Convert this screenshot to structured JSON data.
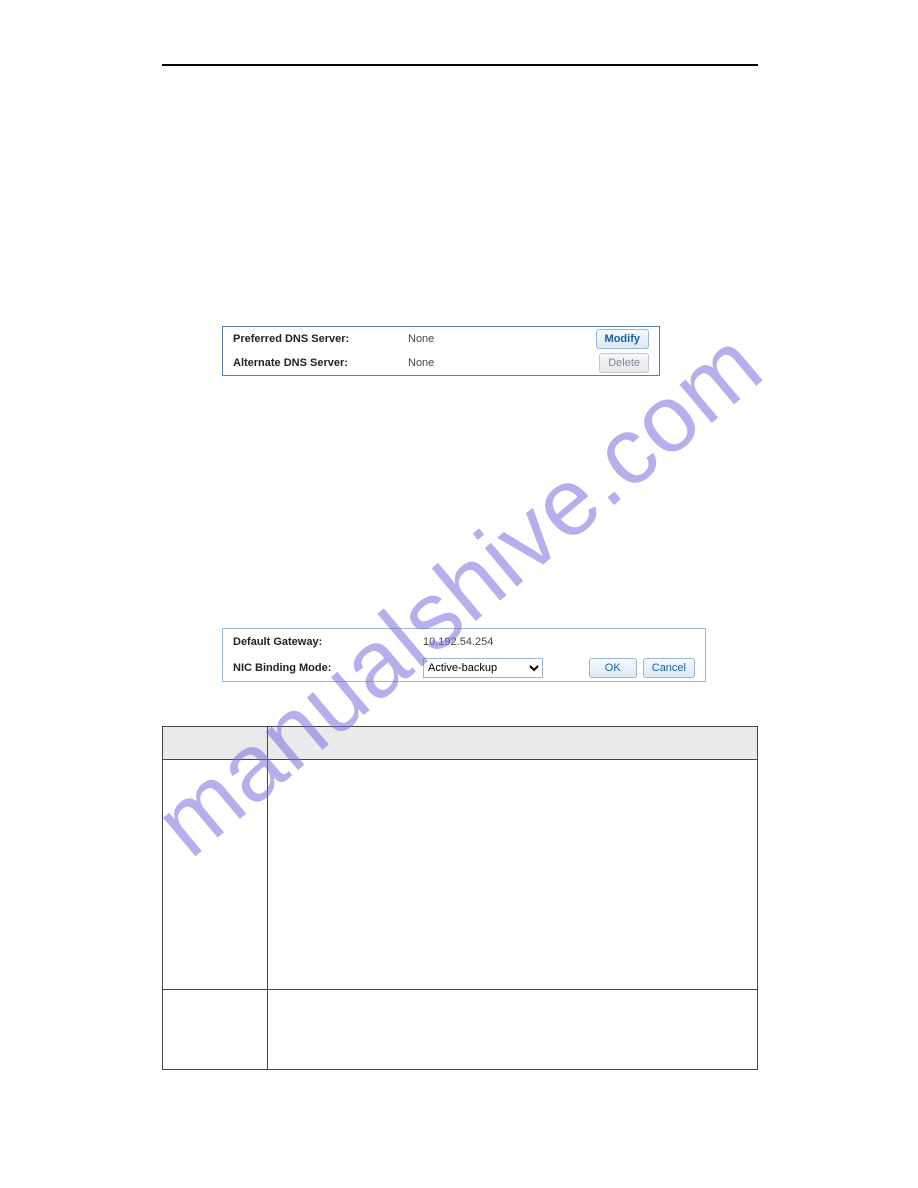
{
  "watermark_text": "manualshive.com",
  "dns": {
    "preferred_label": "Preferred DNS Server:",
    "preferred_value": "None",
    "alternate_label": "Alternate DNS Server:",
    "alternate_value": "None",
    "modify_label": "Modify",
    "delete_label": "Delete"
  },
  "gateway": {
    "default_gateway_label": "Default Gateway:",
    "default_gateway_value": "10.192.54.254",
    "nic_binding_label": "NIC Binding Mode:",
    "nic_binding_selected": "Active-backup",
    "nic_binding_options": [
      "Active-backup"
    ],
    "ok_label": "OK",
    "cancel_label": "Cancel"
  },
  "table": {
    "header_col1": "",
    "header_col2": "",
    "rows": [
      {
        "col1": "",
        "col2": ""
      },
      {
        "col1": "",
        "col2": ""
      }
    ]
  }
}
